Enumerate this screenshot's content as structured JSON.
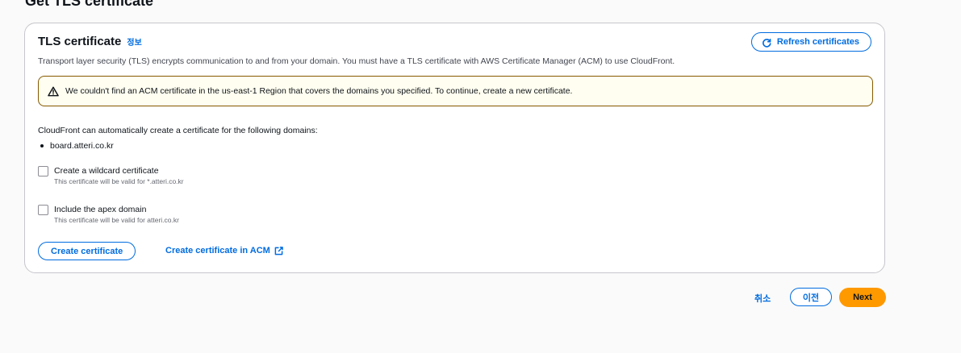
{
  "page": {
    "title": "Get TLS certificate"
  },
  "panel": {
    "title": "TLS certificate",
    "info_link": "정보",
    "refresh_label": "Refresh certificates",
    "description": "Transport layer security (TLS) encrypts communication to and from your domain. You must have a TLS certificate with AWS Certificate Manager (ACM) to use CloudFront.",
    "alert": "We couldn't find an ACM certificate in the us-east-1 Region that covers the domains you specified. To continue, create a new certificate.",
    "auto_text": "CloudFront can automatically create a certificate for the following domains:",
    "domains": [
      "board.atteri.co.kr"
    ],
    "options": [
      {
        "label": "Create a wildcard certificate",
        "help": "This certificate will be valid for *.atteri.co.kr",
        "checked": false
      },
      {
        "label": "Include the apex domain",
        "help": "This certificate will be valid for atteri.co.kr",
        "checked": false
      }
    ],
    "create_button": "Create certificate",
    "acm_link": "Create certificate in ACM"
  },
  "footer": {
    "cancel": "취소",
    "previous": "이전",
    "next": "Next"
  },
  "colors": {
    "accent": "#006ce0",
    "primary_button": "#ff9900",
    "warning_border": "#855900",
    "warning_bg": "#fffef0"
  },
  "icons": {
    "refresh": "refresh-icon",
    "warning": "warning-icon",
    "external": "external-link-icon"
  }
}
